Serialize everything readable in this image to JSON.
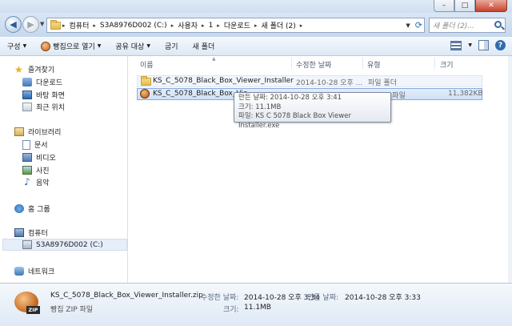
{
  "window": {
    "minimize_label": "–",
    "maximize_label": "□",
    "close_label": "✕"
  },
  "address": {
    "crumbs": [
      "컴퓨터",
      "S3A8976D002 (C:)",
      "사용자",
      "1",
      "다운로드",
      "새 폴더 (2)"
    ],
    "search_placeholder": "새 폴더 (2)..."
  },
  "toolbar": {
    "organize": "구성",
    "open_with": "빵집으로 열기",
    "share": "공유 대상",
    "burn": "굽기",
    "new_folder": "새 폴더"
  },
  "sidebar": {
    "favorites": "즐겨찾기",
    "downloads": "다운로드",
    "desktop": "바탕 화면",
    "recent": "최근 위치",
    "libraries": "라이브러리",
    "documents": "문서",
    "videos": "비디오",
    "pictures": "사진",
    "music": "음악",
    "homegroup": "홈 그룹",
    "computer": "컴퓨터",
    "drive": "S3A8976D002 (C:)",
    "network": "네트워크"
  },
  "columns": {
    "name": "이름",
    "modified": "수정한 날짜",
    "type": "유형",
    "size": "크기"
  },
  "files": [
    {
      "name": "KS_C_5078_Black_Box_Viewer_Installer",
      "modified": "2014-10-28 오후 ...",
      "type": "파일 폴더",
      "size": ""
    },
    {
      "name": "KS_C_5078_Black_Box_Vie",
      "modified": "",
      "type": "P 파일",
      "size": "11,382KB"
    }
  ],
  "tooltip": {
    "created": "만든 날짜: 2014-10-28 오후 3:41",
    "size": "크기: 11.1MB",
    "files": "파일: KS C 5078 Black Box Viewer Installer.exe"
  },
  "details": {
    "filename": "KS_C_5078_Black_Box_Viewer_Installer.zip",
    "filetype": "빵집 ZIP 파일",
    "modified_label": "수정한 날짜:",
    "modified_value": "2014-10-28 오후 3:34",
    "created_label": "만든 날짜:",
    "created_value": "2014-10-28 오후 3:33",
    "size_label": "크기:",
    "size_value": "11.1MB",
    "icon_tag": "ZIP"
  }
}
